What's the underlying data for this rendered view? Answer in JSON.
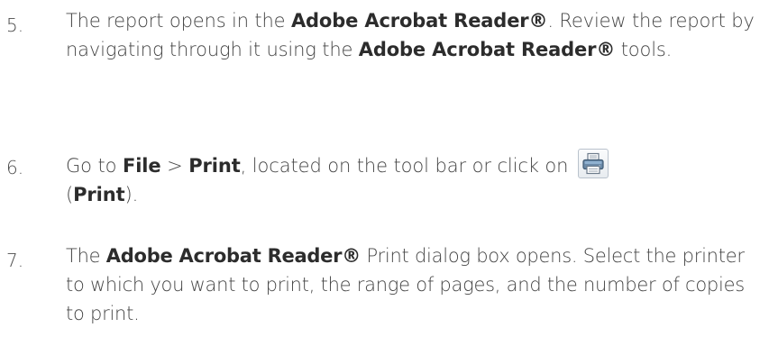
{
  "steps": [
    {
      "number": "5.",
      "t1": "The report opens in the ",
      "b1": "Adobe Acrobat Reader®",
      "t2": ". Review the report by navigating through it using the ",
      "b2": "Adobe Acrobat Reader®",
      "t3": " tools."
    },
    {
      "number": "6.",
      "t1": "Go to ",
      "b1": "File",
      "t2": " > ",
      "b2": "Print",
      "t3": ", located on the tool bar or click on ",
      "icon": "printer-icon",
      "t4": "(",
      "b3": "Print",
      "t5": ")."
    },
    {
      "number": "7.",
      "t1": "The ",
      "b1": "Adobe Acrobat Reader®",
      "t2": " Print dialog box opens. Select the printer to which you want to print, the range of pages, and the number of copies to print."
    }
  ]
}
